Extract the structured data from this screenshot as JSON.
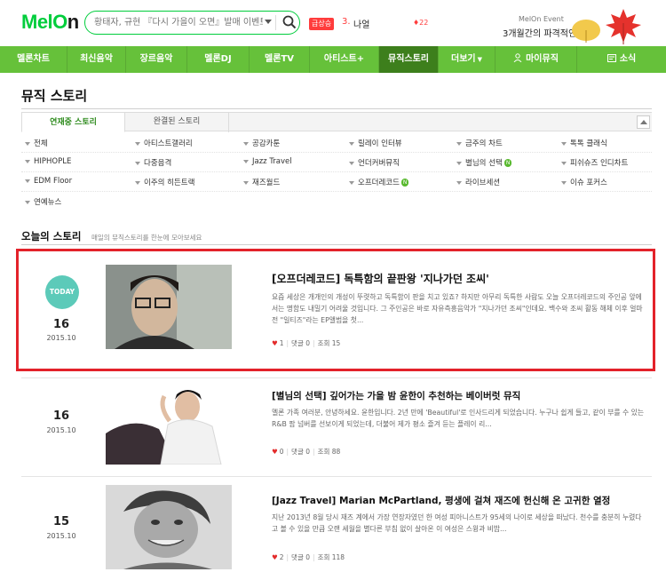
{
  "header": {
    "logo_main": "MelO",
    "logo_accent": "n",
    "search_placeholder": "황태자, 규현 『다시 가을이 오면』발매 이벤트",
    "rank_badge": "급상승",
    "rank_number": "3.",
    "rank_title": "나얼",
    "rank_change": "♦22",
    "event_label": "MelOn Event",
    "event_text": "3개월간의 파격적인 할인"
  },
  "gnb": {
    "items": [
      {
        "label": "멜론차트"
      },
      {
        "label": "최신음악"
      },
      {
        "label": "장르음악"
      },
      {
        "label": "멜론DJ"
      },
      {
        "label": "멜론TV"
      },
      {
        "label": "아티스트+"
      },
      {
        "label": "뮤직스토리"
      },
      {
        "label": "더보기"
      },
      {
        "label": "마이뮤직"
      },
      {
        "label": "소식"
      }
    ]
  },
  "main": {
    "page_title": "뮤직 스토리",
    "tabs": [
      {
        "label": "연재중 스토리"
      },
      {
        "label": "완결된 스토리"
      }
    ],
    "categories": [
      [
        "전체",
        "아티스트갤러리",
        "공감카툰",
        "릴레이 인터뷰",
        "금주의 차트",
        "톡톡 클래식"
      ],
      [
        "HIPHOPLE",
        "다중음격",
        "Jazz Travel",
        "언더커버뮤직",
        "별님의 선택",
        "피쉬슈즈 인디차트"
      ],
      [
        "EDM Floor",
        "이주의 히든트랙",
        "재즈월드",
        "오프더레코드",
        "라이브세션",
        "이슈 포커스"
      ],
      [
        "연예뉴스"
      ]
    ],
    "new_badge": "N",
    "today_title": "오늘의 스토리",
    "today_sub": "매일의 뮤직스토리를 한눈에 모아보세요",
    "stories": [
      {
        "badge": "TODAY",
        "day": "16",
        "year_month": "2015.10",
        "title": "[오프더레코드] 독특함의 끝판왕 '지나가던 조씨'",
        "desc": "요즘 세상은 개개인의 개성이 뚜렷하고 독특함이 판을 치고 있죠? 하지만 아무리 독특한 사람도 오늘 오프더레코드의 주인공 앞에서는 명함도 내밀기 어려울 것입니다. 그 주인공은 바로 자유측흥음악가 \"지나가던 조씨\"인데요. 백수와 조씨 활동 해체 이후 얼마 전 \"일티즈\"라는 EP앨범을 첫...",
        "likes": "1",
        "comments_label": "댓글",
        "comments": "0",
        "views_label": "조회",
        "views": "15"
      },
      {
        "badge": "",
        "day": "16",
        "year_month": "2015.10",
        "title": "[별님의 선택] 깊어가는 가을 밤 윤한이 추천하는 베이버럿 뮤직",
        "desc": "멜론 가족 여러분, 안녕하세요. 윤한입니다. 2년 만에 'Beautiful'로 인사드리게 되었습니다. 누구나 쉽게 들고, 같이 부를 수 있는 R&B 팝 넘버를 선보이게 되었는데, 더불어 제가 평소 즐겨 듣는 플레이 리...",
        "likes": "0",
        "comments_label": "댓글",
        "comments": "0",
        "views_label": "조회",
        "views": "88"
      },
      {
        "badge": "",
        "day": "15",
        "year_month": "2015.10",
        "title": "[Jazz Travel] Marian McPartland, 평생에 걸쳐 재즈에 헌신해 온 고귀한 열정",
        "desc": "지난 2013년 8월 당시 재즈 계에서 가장 연장자였던 한 여성 피아니스트가 95세의 나이로 세상을 떠났다. 천수를 충분히 누렸다고 볼 수 있을 만큼 오랜 세월을 별다른 부침 없이 살아온 이 여성은 스윙과 비밥...",
        "likes": "2",
        "comments_label": "댓글",
        "comments": "0",
        "views_label": "조회",
        "views": "118"
      }
    ]
  },
  "colors": {
    "brand_green": "#00cd3c",
    "nav_green": "#66c13a",
    "nav_active": "#3d7f1c",
    "today_teal": "#5ccab9",
    "highlight_red": "#e3222a",
    "heart_red": "#e32b2b"
  },
  "icons": {
    "search": "search-icon",
    "dropdown": "chevron-down-icon",
    "leaf": "maple-leaf-icon",
    "person": "person-icon",
    "news": "news-icon",
    "heart": "heart-icon",
    "scroll_top": "chevron-up-icon"
  }
}
